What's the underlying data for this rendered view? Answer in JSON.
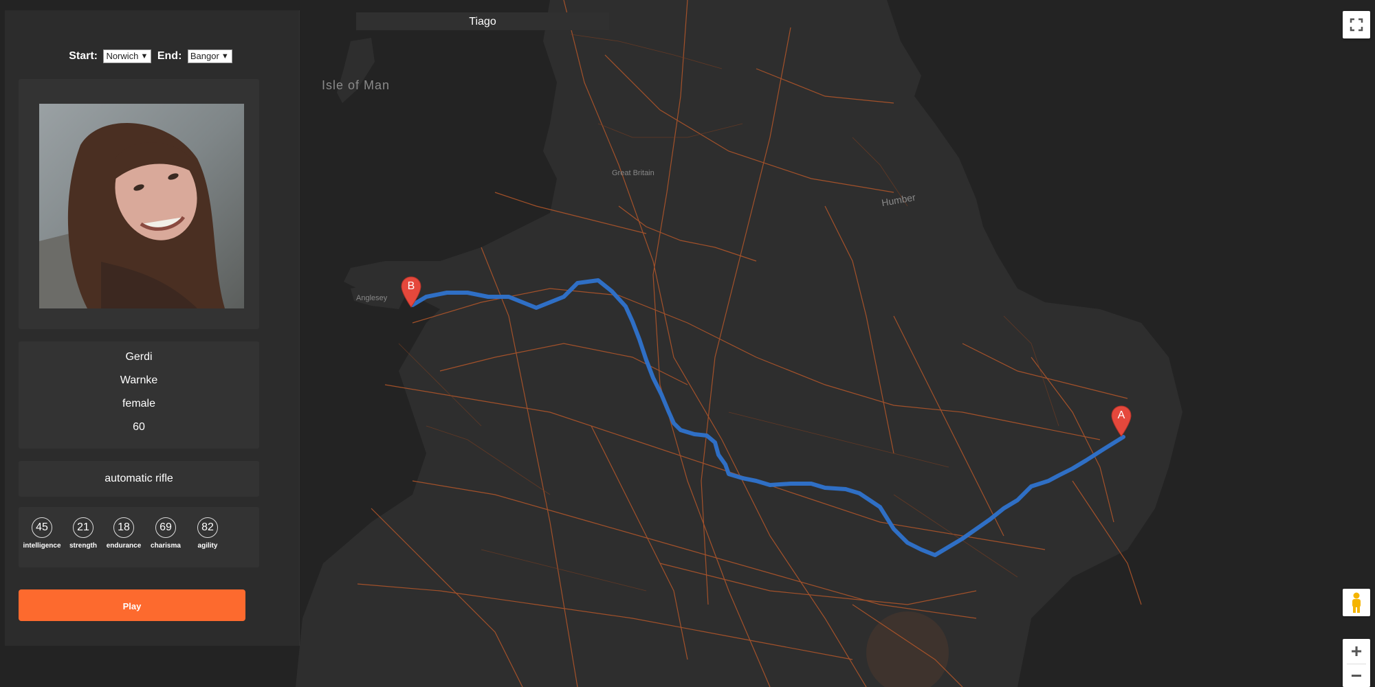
{
  "route_selector": {
    "start_label": "Start:",
    "start_value": "Norwich",
    "end_label": "End:",
    "end_value": "Bangor"
  },
  "map": {
    "title": "Tiago",
    "labels": {
      "isle_of_man": "Isle of Man",
      "great_britain": "Great Britain",
      "humber": "Humber",
      "anglesey": "Anglesey"
    },
    "markers": {
      "start": "A",
      "end": "B"
    },
    "route_color": "#2f6fc5",
    "marker_color": "#e5483c",
    "road_color": "#c9602e"
  },
  "profile": {
    "first_name": "Gerdi",
    "last_name": "Warnke",
    "gender": "female",
    "age": "60",
    "weapon": "automatic rifle"
  },
  "stats": [
    {
      "value": "45",
      "label": "intelligence"
    },
    {
      "value": "21",
      "label": "strength"
    },
    {
      "value": "18",
      "label": "endurance"
    },
    {
      "value": "69",
      "label": "charisma"
    },
    {
      "value": "82",
      "label": "agility"
    }
  ],
  "actions": {
    "play_label": "Play"
  },
  "controls": {
    "fullscreen_icon": "fullscreen-icon",
    "pegman_icon": "pegman-icon",
    "zoom_in": "+",
    "zoom_out": "−"
  },
  "colors": {
    "accent": "#fd6a2e",
    "panel_bg": "#2c2c2c",
    "card_bg": "#333333"
  }
}
